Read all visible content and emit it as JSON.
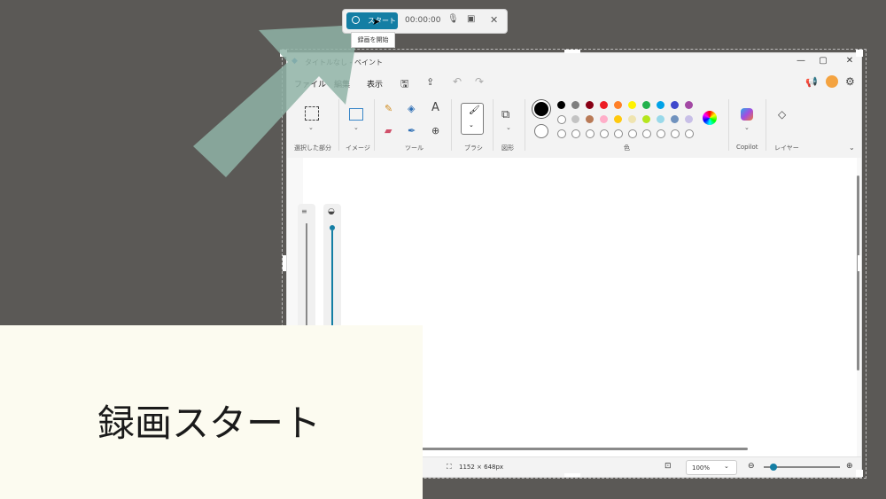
{
  "recording_bar": {
    "start_label": "スタート",
    "timer": "00:00:00",
    "tooltip": "録画を開始"
  },
  "paint": {
    "title": "タイトルなし - ペイント",
    "menu": [
      "ファイル",
      "編集",
      "表示"
    ],
    "groups": {
      "selection": "選択した部分",
      "image": "イメージ",
      "tools": "ツール",
      "brush": "ブラシ",
      "shapes": "図形",
      "colors": "色",
      "copilot": "Copilot",
      "layers": "レイヤー"
    },
    "palette_row1": [
      "#000000",
      "#7f7f7f",
      "#880015",
      "#ed1c24",
      "#ff7f27",
      "#fff200",
      "#22b14c",
      "#00a2e8",
      "#3f48cc",
      "#a349a4"
    ],
    "palette_row2": [
      "#ffffff",
      "#c3c3c3",
      "#b97a57",
      "#ffaec9",
      "#ffc90e",
      "#efe4b0",
      "#b5e61d",
      "#99d9ea",
      "#7092be",
      "#c8bfe7"
    ],
    "status": {
      "dimensions": "1152 × 648px",
      "zoom": "100%"
    }
  },
  "caption": {
    "text": "録画スタート"
  }
}
